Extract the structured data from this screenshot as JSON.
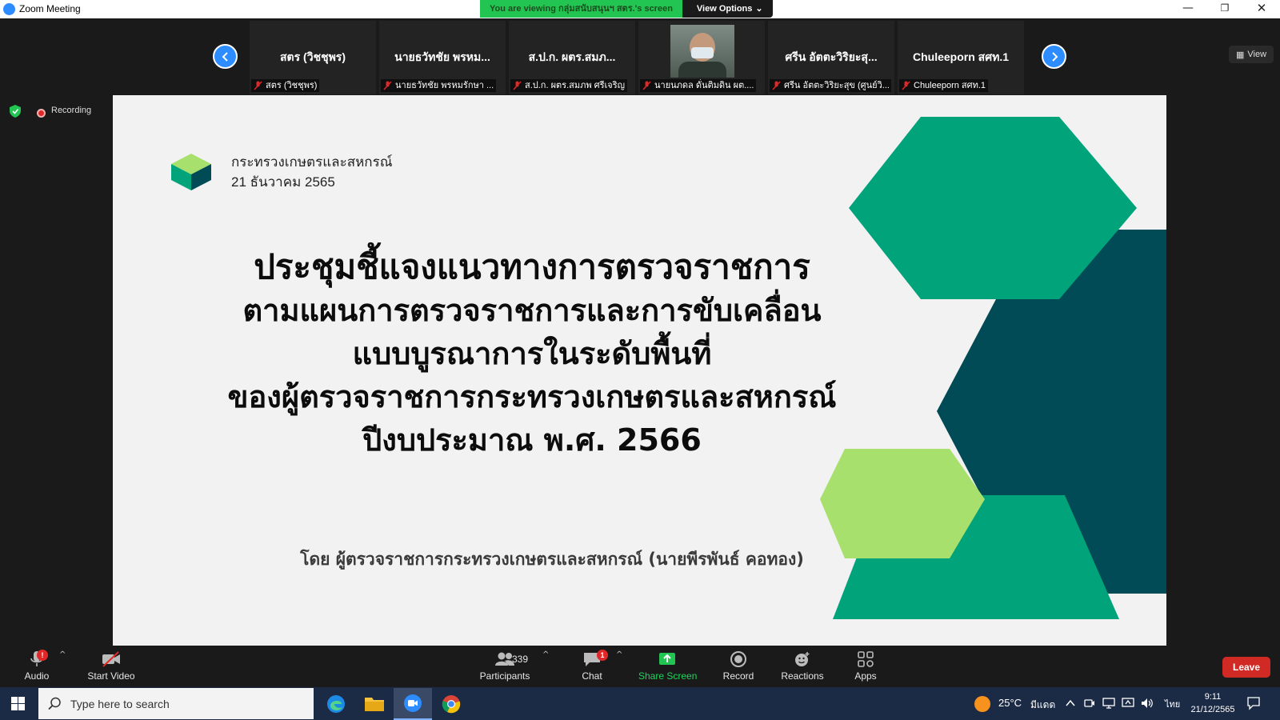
{
  "window": {
    "title": "Zoom Meeting",
    "viewing_banner": "You are viewing กลุ่มสนับสนุนฯ สตร.'s screen",
    "view_options_label": "View Options",
    "view_label": "View"
  },
  "participants": [
    {
      "name": "สตร (วิชชุพร)",
      "label": "สตร (วิชชุพร)",
      "has_video": false
    },
    {
      "name": "นายธวัทชัย พรหม...",
      "label": "นายธวัทชัย พรหมรักษา ...",
      "has_video": false
    },
    {
      "name": "ส.ป.ก. ผตร.สมภ...",
      "label": "ส.ป.ก. ผตร.สมภพ ศรีเจริญ",
      "has_video": false
    },
    {
      "name": "",
      "label": "นายนภดล ดั่นติมดิน ผต....",
      "has_video": true
    },
    {
      "name": "ศรีน อัตตะวิริยะสุ...",
      "label": "ศรีน อัตตะวิริยะสุข (ศูนย์วิ...",
      "has_video": false
    },
    {
      "name": "Chuleeporn สศท.1",
      "label": "Chuleeporn สศท.1",
      "has_video": false
    }
  ],
  "recording_label": "Recording",
  "slide": {
    "org": "กระทรวงเกษตรและสหกรณ์",
    "date": "21 ธันวาคม 2565",
    "title_lines": [
      "ประชุมชี้แจงแนวทางการตรวจราชการ",
      "ตามแผนการตรวจราชการและการขับเคลื่อน",
      "แบบบูรณาการในระดับพื้นที่",
      "ของผู้ตรวจราชการกระทรวงเกษตรและสหกรณ์",
      "ปีงบประมาณ พ.ศ. 2566"
    ],
    "presenter": "โดย ผู้ตรวจราชการกระทรวงเกษตรและสหกรณ์ (นายพีรพันธ์ คอทอง)"
  },
  "controls": {
    "audio": "Audio",
    "audio_badge": "!",
    "start_video": "Start Video",
    "participants": "Participants",
    "participants_count": "339",
    "chat": "Chat",
    "chat_badge": "1",
    "share_screen": "Share Screen",
    "record": "Record",
    "reactions": "Reactions",
    "apps": "Apps",
    "leave": "Leave"
  },
  "taskbar": {
    "search_placeholder": "Type here to search",
    "temperature": "25°C",
    "weather": "มีแดด",
    "language": "ไทย",
    "time": "9:11",
    "date": "21/12/2565"
  },
  "colors": {
    "zoom_blue": "#2d8cff",
    "banner_green": "#23c552",
    "leave_red": "#d12a25",
    "slide_teal": "#00a37a",
    "slide_dark_teal": "#004b55",
    "slide_light_green": "#a8e06e"
  },
  "icons": {
    "mute": "mic-muted-icon",
    "prev": "chevron-left-icon",
    "next": "chevron-right-icon",
    "shield": "shield-icon"
  }
}
